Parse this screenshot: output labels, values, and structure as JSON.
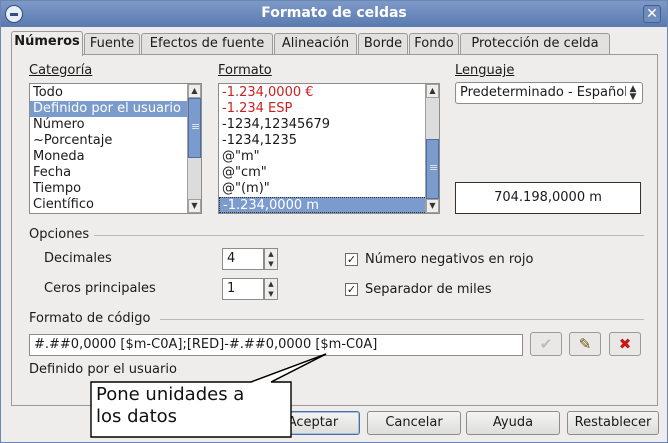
{
  "window": {
    "title": "Formato de celdas"
  },
  "tabs": [
    {
      "label": "Números",
      "active": true
    },
    {
      "label": "Fuente"
    },
    {
      "label": "Efectos de fuente"
    },
    {
      "label": "Alineación"
    },
    {
      "label": "Borde"
    },
    {
      "label": "Fondo"
    },
    {
      "label": "Protección de celda"
    }
  ],
  "categoria": {
    "label": "Categoría",
    "items": [
      "Todo",
      "Definido por el usuario",
      "Número",
      "~Porcentaje",
      "Moneda",
      "Fecha",
      "Tiempo",
      "Científico"
    ],
    "selected_index": 1
  },
  "formato": {
    "label": "Formato",
    "items": [
      "-1.234,0000 €",
      "-1.234 ESP",
      "-1234,12345679",
      "-1234,1235",
      "@\"m\"",
      "@\"cm\"",
      "@\"(m)\"",
      "-1.234,0000 m"
    ],
    "red_indices": [
      0,
      1
    ],
    "selected_index": 7
  },
  "lenguaje": {
    "label": "Lenguaje",
    "value": "Predeterminado - Español (España)"
  },
  "preview": {
    "value": "704.198,0000 m"
  },
  "opciones": {
    "label": "Opciones",
    "decimales_label": "Decimales",
    "decimales_value": "4",
    "ceros_label": "Ceros principales",
    "ceros_value": "1",
    "negativos_label": "Número negativos en rojo",
    "negativos_checked": true,
    "separador_label": "Separador de miles",
    "separador_checked": true
  },
  "codigo": {
    "label": "Formato de código",
    "value": "#.##0,0000 [$m-C0A];[RED]-#.##0,0000 [$m-C0A]",
    "description": "Definido por el usuario"
  },
  "buttons": {
    "accept": "Aceptar",
    "cancel": "Cancelar",
    "help": "Ayuda",
    "reset": "Restablecer"
  },
  "annotation": {
    "line1": "Pone unidades a",
    "line2": "los datos"
  },
  "colors": {
    "accent": "#7b9bcc",
    "titlebar": "#6b88ba",
    "negative": "#cc2020"
  }
}
